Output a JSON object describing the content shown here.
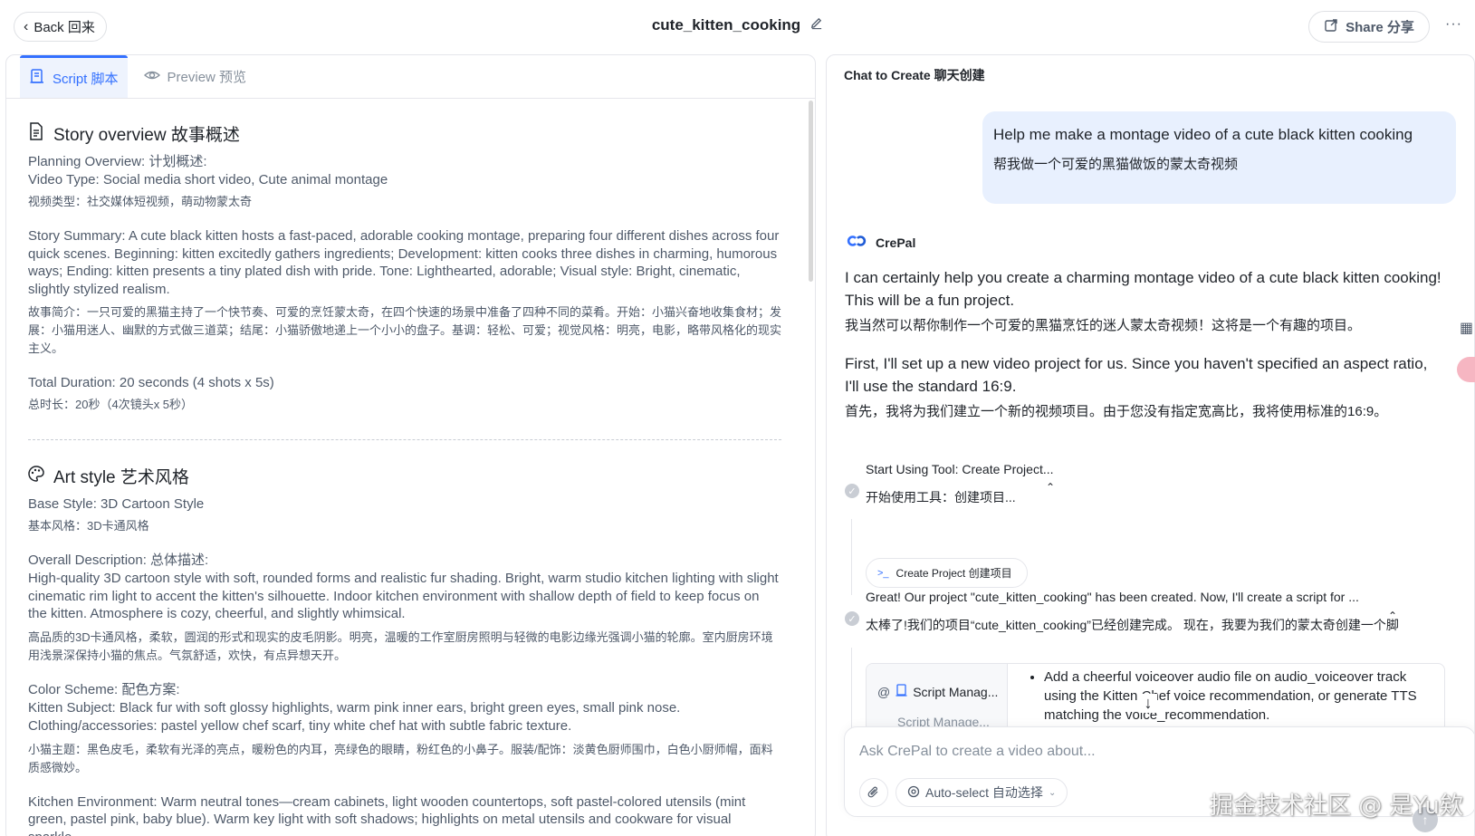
{
  "header": {
    "back_label": "Back 回来",
    "doc_title": "cute_kitten_cooking",
    "share_label": "Share 分享",
    "more": "···"
  },
  "tabs": [
    {
      "label": "Script 脚本",
      "icon": "script-icon",
      "active": true
    },
    {
      "label": "Preview 预览",
      "icon": "eye-icon",
      "active": false
    }
  ],
  "overview": {
    "heading": "Story overview 故事概述",
    "planning_label": "Planning Overview: 计划概述:",
    "video_type_en": "Video Type: Social media short video, Cute animal montage",
    "video_type_zh": "视频类型：社交媒体短视频，萌动物蒙太奇",
    "summary_en": "Story Summary: A cute black kitten hosts a fast-paced, adorable cooking montage, preparing four different dishes across four quick scenes. Beginning: kitten excitedly gathers ingredients; Development: kitten cooks three dishes in charming, humorous ways; Ending: kitten presents a tiny plated dish with pride. Tone: Lighthearted, adorable; Visual style: Bright, cinematic, slightly stylized realism.",
    "summary_zh": "故事简介：一只可爱的黑猫主持了一个快节奏、可爱的烹饪蒙太奇，在四个快速的场景中准备了四种不同的菜肴。开始：小猫兴奋地收集食材；发展：小猫用迷人、幽默的方式做三道菜；结尾：小猫骄傲地递上一个小小的盘子。基调：轻松、可爱；视觉风格：明亮，电影，略带风格化的现实主义。",
    "duration_en": "Total Duration: 20 seconds (4 shots x 5s)",
    "duration_zh": "总时长：20秒（4次镜头x 5秒）"
  },
  "art_style": {
    "heading": "Art style 艺术风格",
    "base_en": "Base Style: 3D Cartoon Style",
    "base_zh": "基本风格：3D卡通风格",
    "desc_label": "Overall Description: 总体描述:",
    "desc_en": "High-quality 3D cartoon style with soft, rounded forms and realistic fur shading. Bright, warm studio kitchen lighting with slight cinematic rim light to accent the kitten's silhouette. Indoor kitchen environment with shallow depth of field to keep focus on the kitten. Atmosphere is cozy, cheerful, and slightly whimsical.",
    "desc_zh": "高品质的3D卡通风格，柔软，圆润的形式和现实的皮毛阴影。明亮，温暖的工作室厨房照明与轻微的电影边缘光强调小猫的轮廓。室内厨房环境用浅景深保持小猫的焦点。气氛舒适，欢快，有点异想天开。",
    "color_label": "Color Scheme: 配色方案:",
    "subject_en_1": "Kitten Subject: Black fur with soft glossy highlights, warm pink inner ears, bright green eyes, small pink nose.",
    "subject_en_2": "Clothing/accessories: pastel yellow chef scarf, tiny white chef hat with subtle fabric texture.",
    "subject_zh": "小猫主题：黑色皮毛，柔软有光泽的亮点，暖粉色的内耳，亮绿色的眼睛，粉红色的小鼻子。服装/配饰：淡黄色厨师围巾，白色小厨师帽，面料质感微妙。",
    "kitchen_en": "Kitchen Environment: Warm neutral tones—cream cabinets, light wooden countertops, soft pastel-colored utensils (mint green, pastel pink, baby blue). Warm key light with soft shadows; highlights on metal utensils and cookware for visual sparkle."
  },
  "chat": {
    "title": "Chat to Create 聊天创建",
    "user_en": "Help me make a montage video of a cute black kitten cooking",
    "user_zh": "帮我做一个可爱的黑猫做饭的蒙太奇视频",
    "bot_name": "CrePal",
    "p1_en": "I can certainly help you create a charming montage video of a cute black kitten cooking! This will be a fun project.",
    "p1_zh": "我当然可以帮你制作一个可爱的黑猫烹饪的迷人蒙太奇视频！这将是一个有趣的项目。",
    "p2_en": "First, I'll set up a new video project for us. Since you haven't specified an aspect ratio, I'll use the standard 16:9.",
    "p2_zh": "首先，我将为我们建立一个新的视频项目。由于您没有指定宽高比，我将使用标准的16:9。",
    "tool1_en": "Start Using Tool: Create Project...",
    "tool1_zh": "开始使用工具：创建项目...",
    "chip_label": "Create Project 创建项目",
    "tool2_en": "Great! Our project \"cute_kitten_cooking\" has been created. Now, I'll create a script for ...",
    "tool2_zh": "太棒了!我们的项目“cute_kitten_cooking”已经创建完成。 现在，我要为我们的蒙太奇创建一个脚",
    "card_item_1": "Script Manag...",
    "card_item_2": "Script Manage...",
    "card_text": "Add a cheerful voiceover audio file on audio_voiceover track using the Kitten Chef voice recommendation, or generate TTS matching the voice_recommendation.",
    "input_placeholder": "Ask CrePal to create a video about...",
    "model_label": "Auto-select 自动选择"
  },
  "watermark": "掘金技术社区 @ 是Yu欸",
  "colors": {
    "accent": "#3370ff",
    "user_bubble": "#e8f0fe",
    "border": "#e5e6eb"
  }
}
